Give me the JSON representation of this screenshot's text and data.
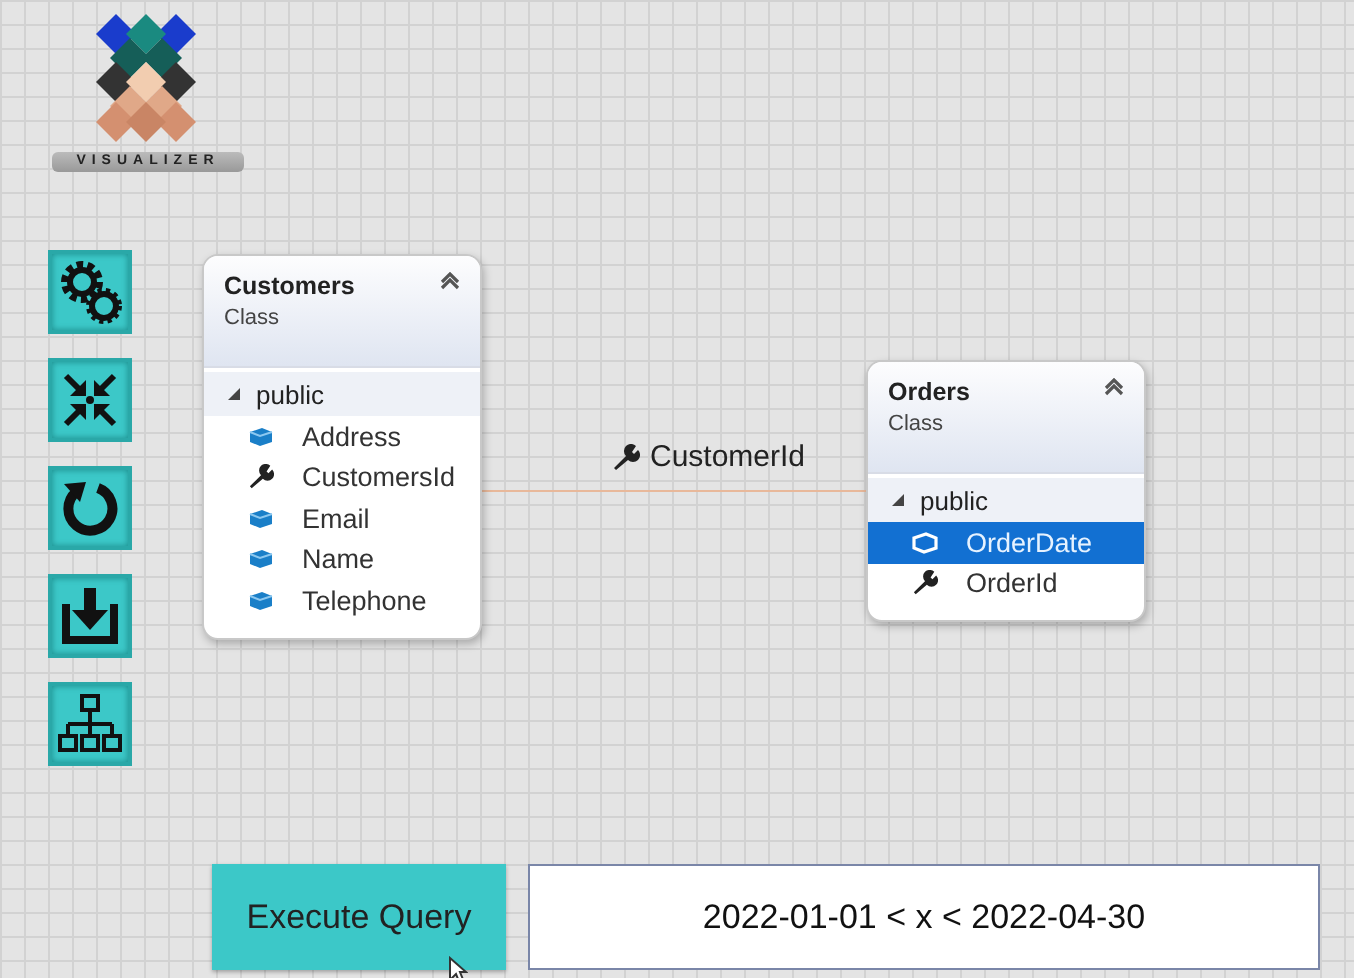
{
  "logo": {
    "text": "VISUALIZER"
  },
  "classes": [
    {
      "name": "Customers",
      "type": "Class",
      "section": "public",
      "members": [
        {
          "name": "Address",
          "kind": "property",
          "selected": false
        },
        {
          "name": "CustomersId",
          "kind": "key",
          "selected": false
        },
        {
          "name": "Email",
          "kind": "property",
          "selected": false
        },
        {
          "name": "Name",
          "kind": "property",
          "selected": false
        },
        {
          "name": "Telephone",
          "kind": "property",
          "selected": false
        }
      ]
    },
    {
      "name": "Orders",
      "type": "Class",
      "section": "public",
      "members": [
        {
          "name": "OrderDate",
          "kind": "property",
          "selected": true
        },
        {
          "name": "OrderId",
          "kind": "key",
          "selected": false
        }
      ]
    }
  ],
  "connector": {
    "label": "CustomerId"
  },
  "query": {
    "button": "Execute Query",
    "value": "2022-01-01 < x < 2022-04-30"
  }
}
